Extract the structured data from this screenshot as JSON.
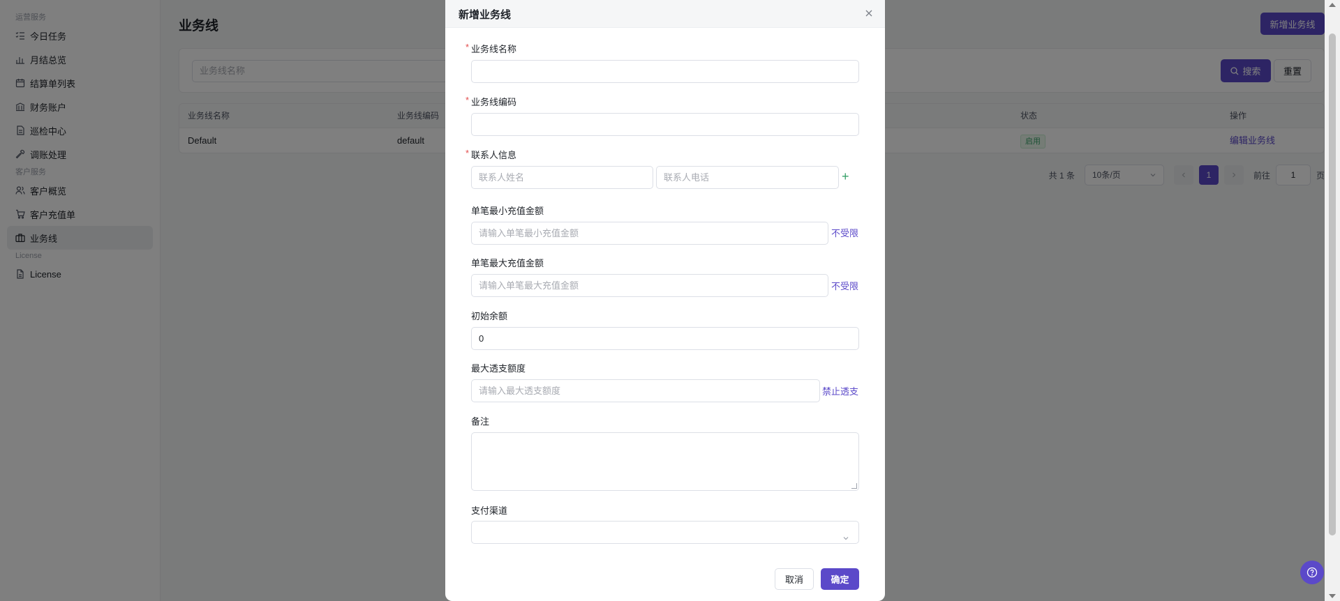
{
  "sidebar": {
    "groups": [
      {
        "label": "运营服务",
        "items": [
          {
            "label": "今日任务",
            "icon": "list-check-icon"
          },
          {
            "label": "月结总览",
            "icon": "bar-chart-icon"
          },
          {
            "label": "结算单列表",
            "icon": "calendar-icon"
          },
          {
            "label": "财务账户",
            "icon": "bank-icon"
          },
          {
            "label": "巡检中心",
            "icon": "document-icon"
          },
          {
            "label": "调账处理",
            "icon": "wrench-icon"
          }
        ]
      },
      {
        "label": "客户服务",
        "items": [
          {
            "label": "客户概览",
            "icon": "users-icon"
          },
          {
            "label": "客户充值单",
            "icon": "cart-icon"
          },
          {
            "label": "业务线",
            "icon": "briefcase-icon",
            "active": true
          }
        ]
      },
      {
        "label": "License",
        "items": [
          {
            "label": "License",
            "icon": "file-icon"
          }
        ]
      }
    ]
  },
  "page": {
    "title": "业务线",
    "new_button": "新增业务线",
    "search_placeholder": "业务线名称",
    "search_button": "搜索",
    "reset_button": "重置"
  },
  "table": {
    "columns": [
      "业务线名称",
      "业务线编码",
      "状态",
      "操作"
    ],
    "rows": [
      {
        "name": "Default",
        "code": "default",
        "status": "启用",
        "action": "编辑业务线"
      }
    ]
  },
  "pagination": {
    "total": "共 1 条",
    "page_size": "10条/页",
    "current": "1",
    "goto_label": "前往",
    "goto_value": "1",
    "page_suffix": "页"
  },
  "dialog": {
    "title": "新增业务线",
    "fields": {
      "name_label": "业务线名称",
      "code_label": "业务线编码",
      "contact_label": "联系人信息",
      "contact_name_placeholder": "联系人姓名",
      "contact_phone_placeholder": "联系人电话",
      "min_label": "单笔最小充值金额",
      "min_placeholder": "请输入单笔最小充值金额",
      "min_link": "不受限",
      "max_label": "单笔最大充值金额",
      "max_placeholder": "请输入单笔最大充值金额",
      "max_link": "不受限",
      "initial_label": "初始余额",
      "initial_value": "0",
      "overdraft_label": "最大透支额度",
      "overdraft_placeholder": "请输入最大透支额度",
      "overdraft_link": "禁止透支",
      "remark_label": "备注",
      "payment_label": "支付渠道"
    },
    "cancel": "取消",
    "confirm": "确定"
  },
  "colors": {
    "accent": "#5b49c9",
    "required": "#e34d4d",
    "success": "#38a169"
  }
}
